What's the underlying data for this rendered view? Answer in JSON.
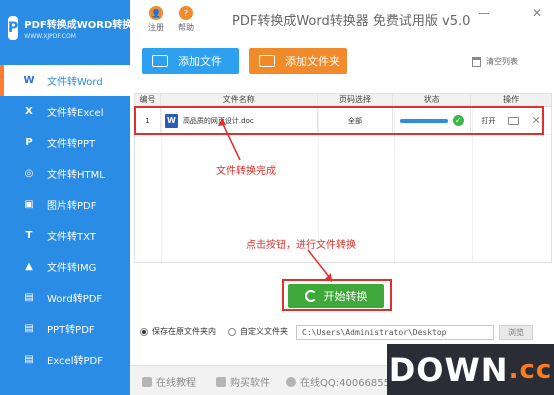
{
  "app": {
    "logo_title": "PDF转换成WORD转换器",
    "logo_sub": "WWW.XJPDF.COM",
    "title": "PDF转换成Word转换器 免费试用版 v5.0",
    "register": "注册",
    "help": "帮助",
    "min_glyph": "—",
    "close_glyph": "✕"
  },
  "sidebar": {
    "items": [
      {
        "label": "文件转Word",
        "icon": "W"
      },
      {
        "label": "文件转Excel",
        "icon": "X"
      },
      {
        "label": "文件转PPT",
        "icon": "P"
      },
      {
        "label": "文件转HTML",
        "icon": "◎"
      },
      {
        "label": "图片转PDF",
        "icon": "▣"
      },
      {
        "label": "文件转TXT",
        "icon": "T"
      },
      {
        "label": "文件转IMG",
        "icon": "▲"
      },
      {
        "label": "Word转PDF",
        "icon": "▤"
      },
      {
        "label": "PPT转PDF",
        "icon": "▤"
      },
      {
        "label": "Excel转PDF",
        "icon": "▤"
      }
    ]
  },
  "toolbar": {
    "add_file": "添加文件",
    "add_folder": "添加文件夹",
    "clear_list": "清空列表"
  },
  "table": {
    "headers": [
      "编号",
      "文件名称",
      "页码选择",
      "状态",
      "操作"
    ],
    "rows": [
      {
        "index": "1",
        "name": "高品质的网页设计.doc",
        "pages": "全部",
        "progress": 1.0,
        "open": "打开",
        "file_icon": "W"
      }
    ]
  },
  "annotations": {
    "done": "文件转换完成",
    "click": "点击按钮，进行文件转换"
  },
  "start_button": "开始转换",
  "output": {
    "save_original": "保存在原文件夹内",
    "custom_folder": "自定义文件夹",
    "path": "C:\\Users\\Administrator\\Desktop",
    "browse": "浏览"
  },
  "footer": {
    "tutorial": "在线教程",
    "buy": "购买软件",
    "qq": "在线QQ:4006685572"
  },
  "watermark": {
    "main": "DOWN",
    "suffix": ".cc"
  },
  "colors": {
    "sidebar": "#2b8ce6",
    "accent_orange": "#f08a2a",
    "start_green": "#3fa83a",
    "annotation_red": "#e0302a"
  }
}
